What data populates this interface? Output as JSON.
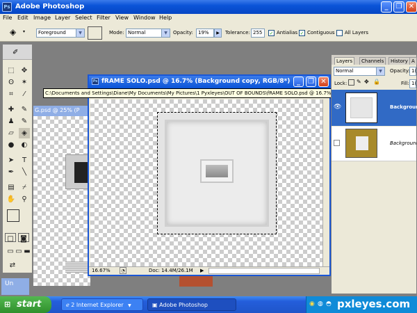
{
  "app": {
    "title": "Adobe Photoshop",
    "logo_text": "Ps",
    "window_buttons": {
      "minimize": "_",
      "restore": "❐",
      "close": "✕"
    }
  },
  "menu": [
    "File",
    "Edit",
    "Image",
    "Layer",
    "Select",
    "Filter",
    "View",
    "Window",
    "Help"
  ],
  "options_bar": {
    "fill_value": "Foreground",
    "mode_label": "Mode:",
    "mode_value": "Normal",
    "opacity_label": "Opacity:",
    "opacity_value": "19%",
    "tolerance_label": "Tolerance:",
    "tolerance_value": "255",
    "antialias_label": "Antialias",
    "antialias_checked": true,
    "contiguous_label": "Contiguous",
    "contiguous_checked": true,
    "all_layers_label": "All Layers",
    "all_layers_checked": false
  },
  "back_document": {
    "title": "G.psd @ 25% (P",
    "tab_label": "Un"
  },
  "document": {
    "title": "fRAME SOLO.psd @ 16.7% (Background copy, RGB/8*)",
    "path_tooltip": "C:\\Documents and Settings\\Diane\\My Documents\\My Pictures\\1 Pyxleyes\\OUT OF BOUNDS\\fRAME SOLO.psd @ 16.7% (Background copy, RGB/8*)",
    "zoom": "16.67%",
    "doc_info": "Doc: 14.4M/26.1M"
  },
  "layers_panel": {
    "tabs": [
      "Layers",
      "Channels",
      "History",
      "A"
    ],
    "blend_mode": "Normal",
    "opacity_label": "Opacity:",
    "opacity_value": "1(",
    "lock_label": "Lock:",
    "fill_label": "Fill:",
    "fill_value": "1(",
    "layers": [
      {
        "name": "Backgroun",
        "selected": true
      },
      {
        "name": "Background",
        "selected": false
      }
    ]
  },
  "taskbar": {
    "start_label": "start",
    "items": [
      "2 Internet Explorer",
      "Adobe Photoshop"
    ],
    "watermark": "pxleyes.com"
  },
  "colors": {
    "xp_blue": "#0a54d8",
    "xp_green": "#2f8f2c",
    "panel_bg": "#ece9d8",
    "selected_layer": "#316ac5"
  }
}
